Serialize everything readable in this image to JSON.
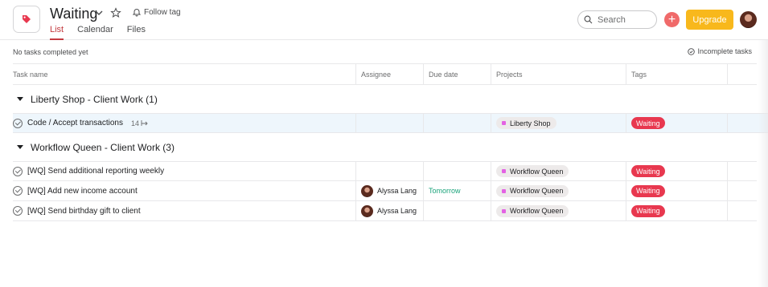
{
  "header": {
    "title": "Waiting",
    "follow_label": "Follow tag",
    "tabs": [
      {
        "label": "List",
        "active": true
      },
      {
        "label": "Calendar",
        "active": false
      },
      {
        "label": "Files",
        "active": false
      }
    ],
    "search_placeholder": "Search",
    "plus_label": "+",
    "upgrade_label": "Upgrade"
  },
  "status": {
    "left": "No tasks completed yet",
    "right": "Incomplete tasks"
  },
  "columns": {
    "name": "Task name",
    "assignee": "Assignee",
    "due": "Due date",
    "projects": "Projects",
    "tags": "Tags"
  },
  "sections": [
    {
      "label": "Liberty Shop - Client Work (1)",
      "tasks": [
        {
          "name": "Code / Accept transactions",
          "subtasks": "14",
          "assignee": "",
          "due": "",
          "project": "Liberty Shop",
          "tag": "Waiting",
          "highlighted": true
        }
      ]
    },
    {
      "label": "Workflow Queen - Client Work (3)",
      "tasks": [
        {
          "name": "[WQ] Send additional reporting weekly",
          "assignee": "",
          "due": "",
          "project": "Workflow Queen",
          "tag": "Waiting"
        },
        {
          "name": "[WQ] Add new income account",
          "assignee": "Alyssa Lang",
          "due": "Tomorrow",
          "project": "Workflow Queen",
          "tag": "Waiting"
        },
        {
          "name": "[WQ] Send birthday gift to client",
          "assignee": "Alyssa Lang",
          "due": "",
          "project": "Workflow Queen",
          "tag": "Waiting"
        }
      ]
    }
  ],
  "colors": {
    "accent": "#c33a3f",
    "upgrade": "#f8b81c",
    "tag": "#e8384f",
    "project_dot": "#e362e3",
    "due_soon": "#1aa37a"
  }
}
